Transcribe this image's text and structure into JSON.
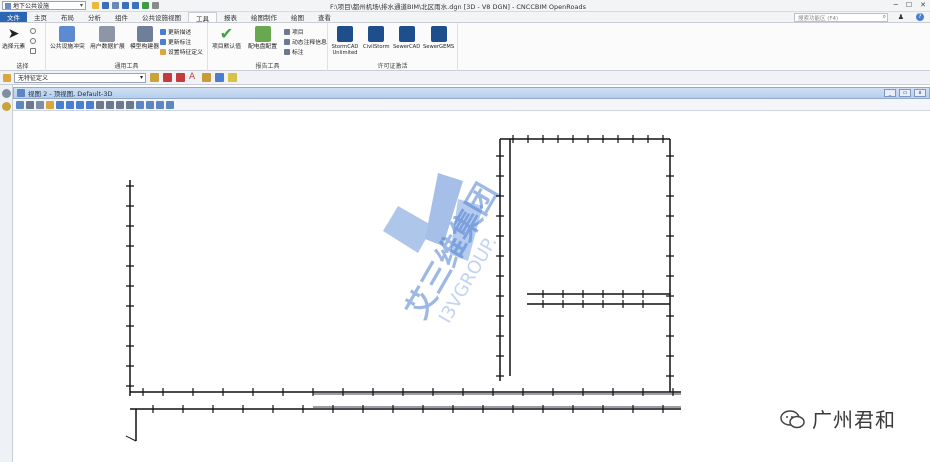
{
  "titlebar": {
    "workspace": "地下公共设施",
    "title": "F:\\项目\\都州机场\\排水通道BIM\\北区雨水.dgn [3D - V8 DGN] - CNCCBIM OpenRoads"
  },
  "tabs": [
    {
      "label": "文件",
      "kind": "file"
    },
    {
      "label": "主页"
    },
    {
      "label": "布局"
    },
    {
      "label": "分析"
    },
    {
      "label": "组件"
    },
    {
      "label": "公共设施视图"
    },
    {
      "label": "工具",
      "kind": "active"
    },
    {
      "label": "报表"
    },
    {
      "label": "绘图制作"
    },
    {
      "label": "绘图"
    },
    {
      "label": "查看"
    }
  ],
  "search": {
    "placeholder": "搜索功能区 (F4)"
  },
  "ribbon": {
    "select_group": {
      "label": "选择",
      "button": "选择元素"
    },
    "general_tools": {
      "label": "通用工具",
      "buttons": [
        "公共设施冲突",
        "用户数据扩展",
        "模型构建器"
      ],
      "small": [
        "更新描述",
        "更新标注",
        "设置特征定义"
      ]
    },
    "drawing_tools": {
      "label": "报告工具",
      "buttons": [
        "项目默认值",
        "配电盘配置"
      ],
      "small": [
        "项目",
        "动态注释信息",
        "标注"
      ]
    },
    "license_tools": {
      "label": "许可证激活",
      "buttons": [
        "StormCAD Unlimited",
        "CivilStorm",
        "SewerCAD",
        "SewerGEMS"
      ]
    }
  },
  "levelbar": {
    "level": "无特征定义"
  },
  "view": {
    "title": "视图 2 - 顶视图, Default-3D"
  },
  "watermark": {
    "cn": "艾三维集团",
    "en": "I3VGROUP."
  },
  "weibo": {
    "label": "广州君和"
  },
  "colors": {
    "file_tab": "#2b66b3",
    "watermark": "#4f7fd0",
    "view_header": "#b6cdea"
  }
}
